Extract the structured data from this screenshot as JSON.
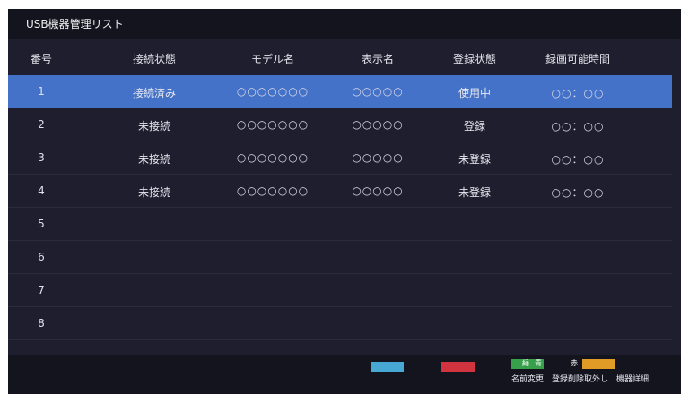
{
  "window": {
    "title": "USB機器管理リスト"
  },
  "table": {
    "columns": [
      "番号",
      "接続状態",
      "モデル名",
      "表示名",
      "登録状態",
      "録画可能時間"
    ],
    "rows": [
      {
        "number": "1",
        "connection": "接続済み",
        "model": "○○○○○○○",
        "display_name": "○○○○○",
        "registration": "使用中",
        "recordable_time": "○○：○○",
        "selected": true
      },
      {
        "number": "2",
        "connection": "未接続",
        "model": "○○○○○○○",
        "display_name": "○○○○○",
        "registration": "登録",
        "recordable_time": "○○：○○"
      },
      {
        "number": "3",
        "connection": "未接続",
        "model": "○○○○○○○",
        "display_name": "○○○○○",
        "registration": "未登録",
        "recordable_time": "○○：○○"
      },
      {
        "number": "4",
        "connection": "未接続",
        "model": "○○○○○○○",
        "display_name": "○○○○○",
        "registration": "未登録",
        "recordable_time": "○○：○○"
      },
      {
        "number": "5"
      },
      {
        "number": "6"
      },
      {
        "number": "7"
      },
      {
        "number": "8"
      }
    ]
  },
  "footer": {
    "green_text": "緑",
    "green_text_2": "青",
    "green_text_3": "赤",
    "labels": "名前変更　登録削除取外し　機器詳細"
  },
  "colors": {
    "background": "#1f1e2e",
    "selected_row": "#4372c8",
    "blue_button": "#47a8d4",
    "red_button": "#d2343f",
    "green_button": "#36a14a",
    "yellow_button": "#e09a26"
  }
}
